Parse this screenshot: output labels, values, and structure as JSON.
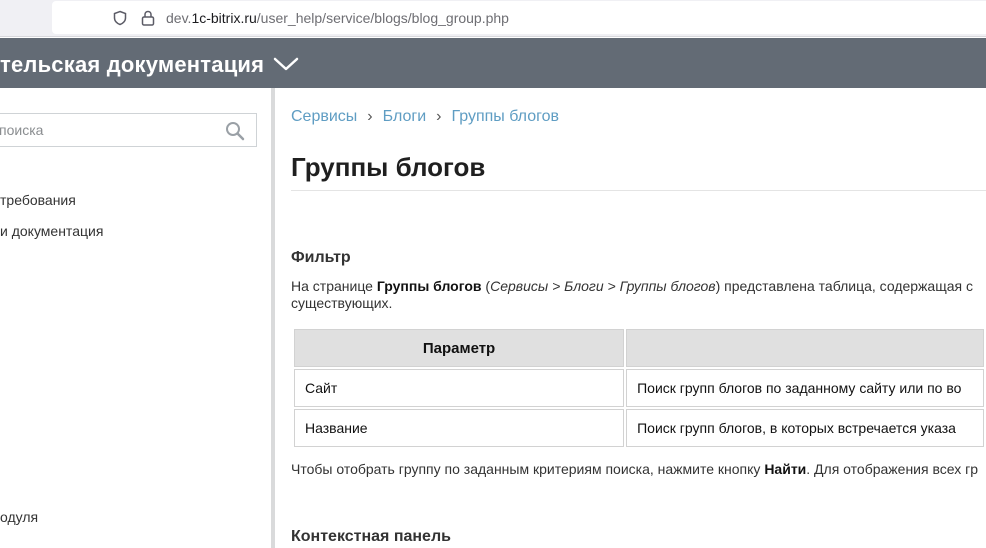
{
  "browser": {
    "url_domain_prefix": "dev.",
    "url_domain": "1c-bitrix.ru",
    "url_path": "/user_help/service/blogs/blog_group.php"
  },
  "header": {
    "title": "тельская документация"
  },
  "sidebar": {
    "search_placeholder": "поиска",
    "items": [
      {
        "label": "требования"
      },
      {
        "label": "и документация"
      },
      {
        "label": "одуля"
      }
    ]
  },
  "breadcrumb": {
    "items": [
      "Сервисы",
      "Блоги",
      "Группы блогов"
    ],
    "separator": "›"
  },
  "page": {
    "title": "Группы блогов",
    "filter_heading": "Фильтр",
    "intro": {
      "p1": "На странице ",
      "b1": "Группы блогов",
      "p2": " (",
      "i1": "Сервисы > Блоги > Группы блогов",
      "p3": ") представлена таблица, содержащая с",
      "line2": "существующих."
    },
    "table": {
      "headers": [
        "Параметр",
        ""
      ],
      "rows": [
        [
          "Сайт",
          "Поиск групп блогов по заданному сайту или по во"
        ],
        [
          "Название",
          "Поиск групп блогов, в которых встречается указа"
        ]
      ]
    },
    "note": {
      "p1": "Чтобы отобрать группу по заданным критериям поиска, нажмите кнопку ",
      "b1": "Найти",
      "p2": ". Для отображения всех гр"
    },
    "context_heading": "Контекстная панель"
  }
}
